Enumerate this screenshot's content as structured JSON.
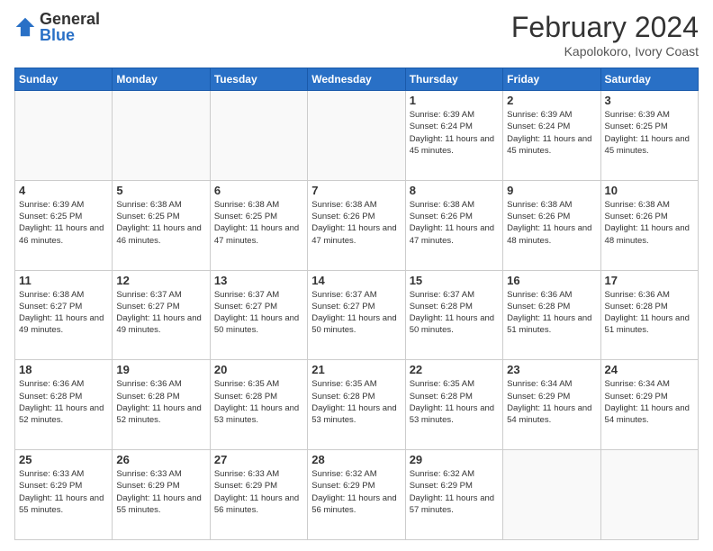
{
  "logo": {
    "general": "General",
    "blue": "Blue"
  },
  "header": {
    "month": "February 2024",
    "location": "Kapolokoro, Ivory Coast"
  },
  "weekdays": [
    "Sunday",
    "Monday",
    "Tuesday",
    "Wednesday",
    "Thursday",
    "Friday",
    "Saturday"
  ],
  "weeks": [
    [
      {
        "day": "",
        "empty": true
      },
      {
        "day": "",
        "empty": true
      },
      {
        "day": "",
        "empty": true
      },
      {
        "day": "",
        "empty": true
      },
      {
        "day": "1",
        "sunrise": "6:39 AM",
        "sunset": "6:24 PM",
        "daylight": "11 hours and 45 minutes."
      },
      {
        "day": "2",
        "sunrise": "6:39 AM",
        "sunset": "6:24 PM",
        "daylight": "11 hours and 45 minutes."
      },
      {
        "day": "3",
        "sunrise": "6:39 AM",
        "sunset": "6:25 PM",
        "daylight": "11 hours and 45 minutes."
      }
    ],
    [
      {
        "day": "4",
        "sunrise": "6:39 AM",
        "sunset": "6:25 PM",
        "daylight": "11 hours and 46 minutes."
      },
      {
        "day": "5",
        "sunrise": "6:38 AM",
        "sunset": "6:25 PM",
        "daylight": "11 hours and 46 minutes."
      },
      {
        "day": "6",
        "sunrise": "6:38 AM",
        "sunset": "6:25 PM",
        "daylight": "11 hours and 47 minutes."
      },
      {
        "day": "7",
        "sunrise": "6:38 AM",
        "sunset": "6:26 PM",
        "daylight": "11 hours and 47 minutes."
      },
      {
        "day": "8",
        "sunrise": "6:38 AM",
        "sunset": "6:26 PM",
        "daylight": "11 hours and 47 minutes."
      },
      {
        "day": "9",
        "sunrise": "6:38 AM",
        "sunset": "6:26 PM",
        "daylight": "11 hours and 48 minutes."
      },
      {
        "day": "10",
        "sunrise": "6:38 AM",
        "sunset": "6:26 PM",
        "daylight": "11 hours and 48 minutes."
      }
    ],
    [
      {
        "day": "11",
        "sunrise": "6:38 AM",
        "sunset": "6:27 PM",
        "daylight": "11 hours and 49 minutes."
      },
      {
        "day": "12",
        "sunrise": "6:37 AM",
        "sunset": "6:27 PM",
        "daylight": "11 hours and 49 minutes."
      },
      {
        "day": "13",
        "sunrise": "6:37 AM",
        "sunset": "6:27 PM",
        "daylight": "11 hours and 50 minutes."
      },
      {
        "day": "14",
        "sunrise": "6:37 AM",
        "sunset": "6:27 PM",
        "daylight": "11 hours and 50 minutes."
      },
      {
        "day": "15",
        "sunrise": "6:37 AM",
        "sunset": "6:28 PM",
        "daylight": "11 hours and 50 minutes."
      },
      {
        "day": "16",
        "sunrise": "6:36 AM",
        "sunset": "6:28 PM",
        "daylight": "11 hours and 51 minutes."
      },
      {
        "day": "17",
        "sunrise": "6:36 AM",
        "sunset": "6:28 PM",
        "daylight": "11 hours and 51 minutes."
      }
    ],
    [
      {
        "day": "18",
        "sunrise": "6:36 AM",
        "sunset": "6:28 PM",
        "daylight": "11 hours and 52 minutes."
      },
      {
        "day": "19",
        "sunrise": "6:36 AM",
        "sunset": "6:28 PM",
        "daylight": "11 hours and 52 minutes."
      },
      {
        "day": "20",
        "sunrise": "6:35 AM",
        "sunset": "6:28 PM",
        "daylight": "11 hours and 53 minutes."
      },
      {
        "day": "21",
        "sunrise": "6:35 AM",
        "sunset": "6:28 PM",
        "daylight": "11 hours and 53 minutes."
      },
      {
        "day": "22",
        "sunrise": "6:35 AM",
        "sunset": "6:28 PM",
        "daylight": "11 hours and 53 minutes."
      },
      {
        "day": "23",
        "sunrise": "6:34 AM",
        "sunset": "6:29 PM",
        "daylight": "11 hours and 54 minutes."
      },
      {
        "day": "24",
        "sunrise": "6:34 AM",
        "sunset": "6:29 PM",
        "daylight": "11 hours and 54 minutes."
      }
    ],
    [
      {
        "day": "25",
        "sunrise": "6:33 AM",
        "sunset": "6:29 PM",
        "daylight": "11 hours and 55 minutes."
      },
      {
        "day": "26",
        "sunrise": "6:33 AM",
        "sunset": "6:29 PM",
        "daylight": "11 hours and 55 minutes."
      },
      {
        "day": "27",
        "sunrise": "6:33 AM",
        "sunset": "6:29 PM",
        "daylight": "11 hours and 56 minutes."
      },
      {
        "day": "28",
        "sunrise": "6:32 AM",
        "sunset": "6:29 PM",
        "daylight": "11 hours and 56 minutes."
      },
      {
        "day": "29",
        "sunrise": "6:32 AM",
        "sunset": "6:29 PM",
        "daylight": "11 hours and 57 minutes."
      },
      {
        "day": "",
        "empty": true
      },
      {
        "day": "",
        "empty": true
      }
    ]
  ]
}
